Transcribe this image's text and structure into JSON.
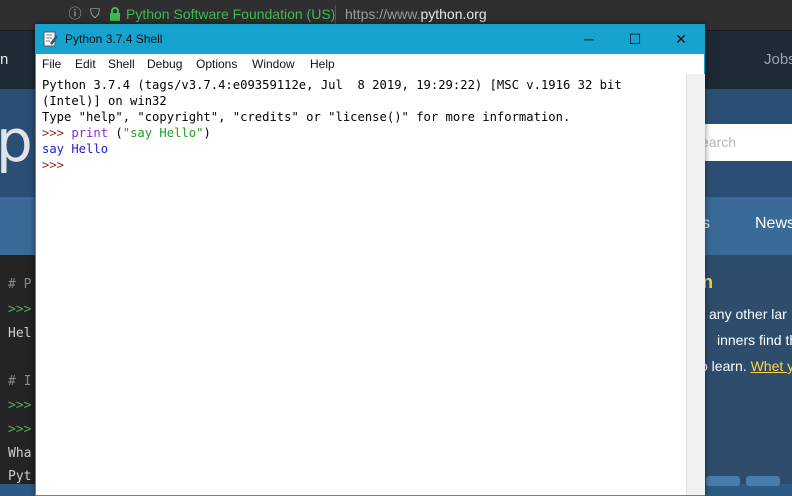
{
  "browser": {
    "secure_label": "Python Software Foundation (US)",
    "url_prefix": "https://www.",
    "url_domain": "python.org"
  },
  "website": {
    "top_left_fragment": "n",
    "top_right_link": "Jobs",
    "logo_fragment": "py",
    "search_placeholder": "earch",
    "nav_fragment": "s",
    "nav_news": "News",
    "terminal_lines": [
      "# P",
      ">>>",
      "Hel",
      "# I",
      ">>>",
      ">>>",
      "Wha",
      "Pyt"
    ],
    "intro_heading": "n",
    "intro_lines": [
      "any other lar",
      "inners find th",
      "o learn. "
    ],
    "intro_link": "Whet y"
  },
  "window": {
    "title": "Python 3.7.4 Shell",
    "controls": {
      "minimize": "─",
      "maximize": "☐",
      "close": "✕"
    },
    "menu": [
      "File",
      "Edit",
      "Shell",
      "Debug",
      "Options",
      "Window",
      "Help"
    ]
  },
  "shell": {
    "banner_line1": "Python 3.7.4 (tags/v3.7.4:e09359112e, Jul  8 2019, 19:29:22) [MSC v.1916 32 bit",
    "banner_line2": "(Intel)] on win32",
    "banner_line3": "Type \"help\", \"copyright\", \"credits\" or \"license()\" for more information.",
    "prompt": ">>> ",
    "command_keyword": "print",
    "command_args_open": " (",
    "command_string": "\"say Hello\"",
    "command_args_close": ")",
    "output": "say Hello",
    "final_prompt": ">>> "
  }
}
